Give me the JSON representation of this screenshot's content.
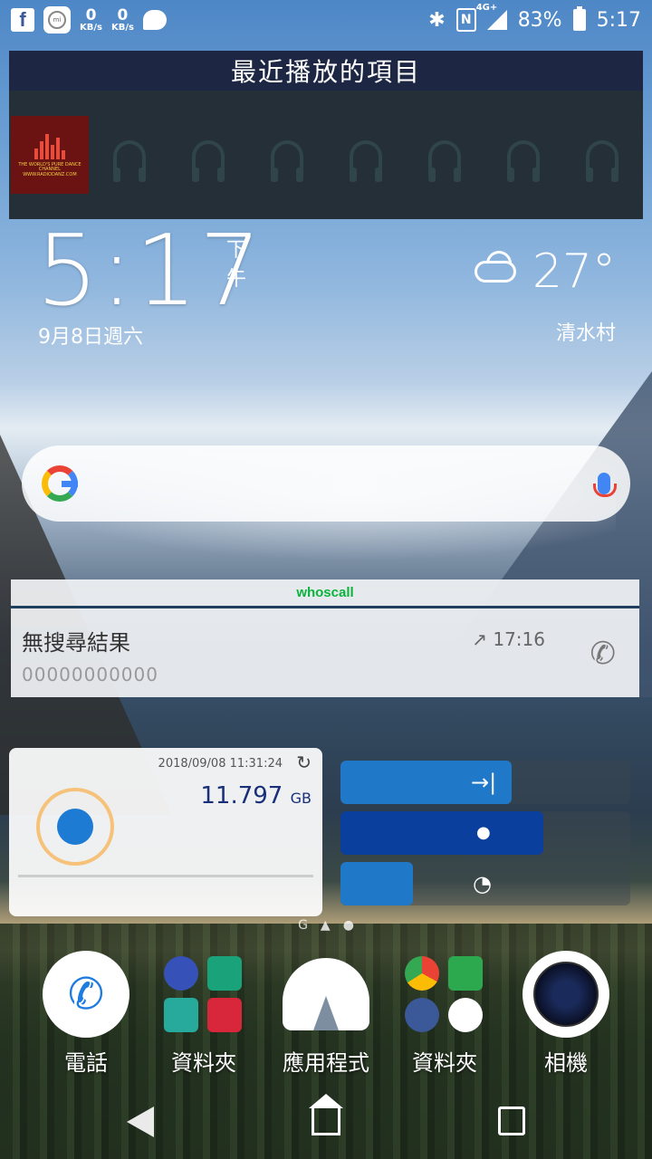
{
  "status_bar": {
    "speeds": [
      {
        "value": "0",
        "unit": "KB/s"
      },
      {
        "value": "0",
        "unit": "KB/s"
      }
    ],
    "network": "4G+",
    "battery": "83%",
    "time": "5:17",
    "icons": [
      "facebook-icon",
      "mi-icon",
      "chat-icon",
      "bluetooth-icon",
      "nfc-icon",
      "signal-icon",
      "battery-icon"
    ]
  },
  "recent_widget": {
    "title": "最近播放的項目",
    "station_caption": "THE WORLD'S PURE DANCE CHANNEL WWW.RADIODANZ.COM",
    "empty_slots": 7
  },
  "clock": {
    "time": "5:17",
    "ampm": "下午",
    "date": "9月8日週六"
  },
  "weather": {
    "temp": "27°",
    "city": "清水村"
  },
  "whoscall": {
    "brand": "whoscall",
    "title": "無搜尋結果",
    "number": "00000000000",
    "time": "↗ 17:16"
  },
  "data_usage": {
    "timestamp": "2018/09/08 11:31:24",
    "value": "11.797",
    "unit": "GB",
    "accent": "#1a2f7a"
  },
  "toggles": [
    {
      "icon": "→|",
      "fill": 0.59,
      "color": "#1f78c8"
    },
    {
      "icon": "●",
      "fill": 0.7,
      "color": "#0b3f9e"
    },
    {
      "icon": "◔",
      "fill": 0.25,
      "color": "#1f78c8"
    }
  ],
  "pager": {
    "g": "G",
    "home": "▲",
    "dot": "●"
  },
  "dock": [
    {
      "label": "電話"
    },
    {
      "label": "資料夾"
    },
    {
      "label": "應用程式"
    },
    {
      "label": "資料夾"
    },
    {
      "label": "相機"
    }
  ]
}
